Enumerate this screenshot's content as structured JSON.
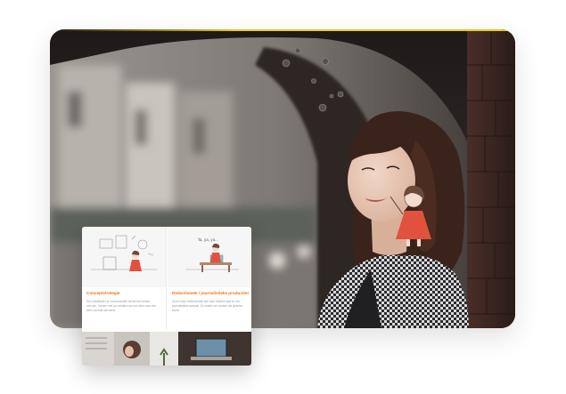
{
  "colors": {
    "accent": "#e8761f",
    "accent_line": "#f0c419",
    "card_shadow": "rgba(0,0,0,0.22)"
  },
  "preview": {
    "cards": [
      {
        "title": "Conceptstrategie",
        "text": "Wij ontwikkelen je communicatie vanuit een helder concept. Samen met jou vertalen we een idee naar een sterk verhaal dat werkt."
      },
      {
        "title": "Redactionele / journalistieke producties",
        "speech": "Ya, ya, ya...",
        "text": "Onze copy onderscheidt zich door heldere taal en een journalistieke aanpak. Zo maken we content die gelezen wordt."
      }
    ]
  }
}
